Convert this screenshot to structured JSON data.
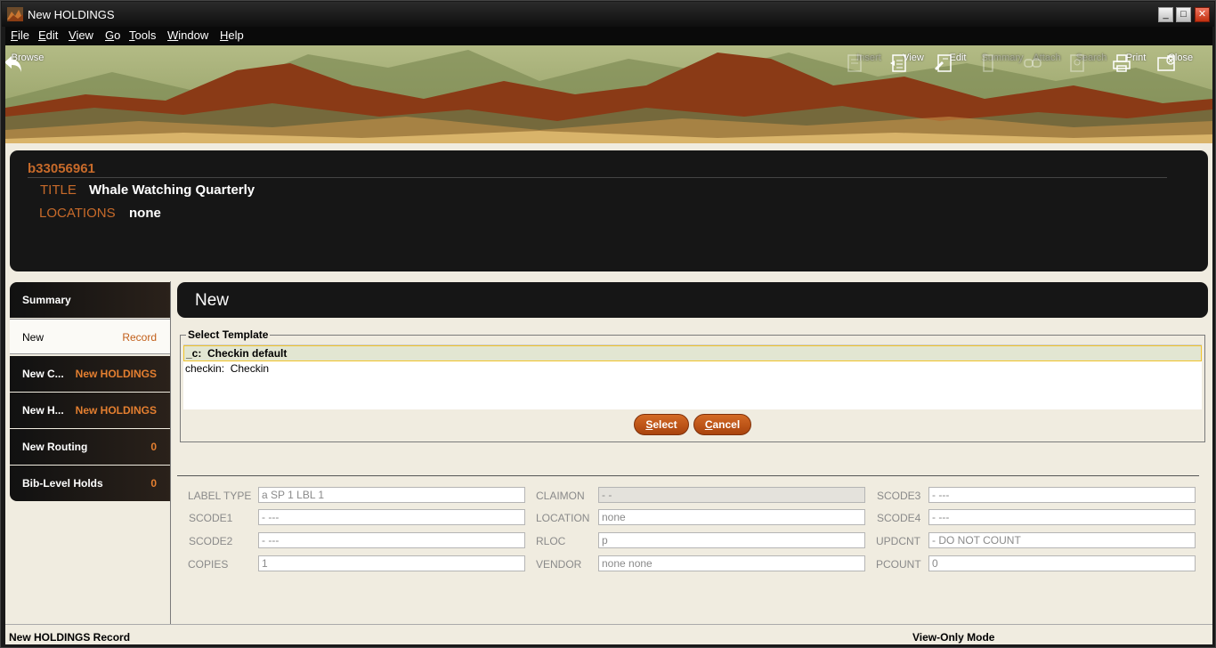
{
  "window": {
    "title": "New HOLDINGS",
    "controls": {
      "minimize": "_",
      "maximize": "□",
      "close": "✕"
    }
  },
  "menu": [
    "File",
    "Edit",
    "View",
    "Go",
    "Tools",
    "Window",
    "Help"
  ],
  "toolbar": {
    "browse": "Browse",
    "right": [
      {
        "label": "Insert",
        "icon": "insert-icon",
        "enabled": false
      },
      {
        "label": "View",
        "icon": "view-icon",
        "enabled": true
      },
      {
        "label": "Edit",
        "icon": "edit-icon",
        "enabled": true
      },
      {
        "label": "Summary",
        "icon": "summary-icon",
        "enabled": false
      },
      {
        "label": "Attach",
        "icon": "attach-icon",
        "enabled": false
      },
      {
        "label": "Search",
        "icon": "search-icon",
        "enabled": false
      },
      {
        "label": "Print",
        "icon": "print-icon",
        "enabled": true
      },
      {
        "label": "Close",
        "icon": "close-icon",
        "enabled": true
      }
    ]
  },
  "record": {
    "number": "b33056961",
    "title_label": "TITLE",
    "title_value": "Whale Watching Quarterly",
    "locations_label": "LOCATIONS",
    "locations_value": "none"
  },
  "nav": [
    {
      "label": "Summary",
      "value": ""
    },
    {
      "label": "New",
      "value": "Record"
    },
    {
      "label": "New C...",
      "value": "New HOLDINGS"
    },
    {
      "label": "New H...",
      "value": "New HOLDINGS"
    },
    {
      "label": "New Routing",
      "value": "0"
    },
    {
      "label": "Bib-Level Holds",
      "value": "0"
    }
  ],
  "panel": {
    "title": "New",
    "template_legend": "Select Template",
    "templates": [
      {
        "code": "_c:",
        "name": "Checkin default",
        "selected": true
      },
      {
        "code": "checkin:",
        "name": "Checkin",
        "selected": false
      }
    ],
    "select_label": "Select",
    "cancel_label": "Cancel"
  },
  "fields": {
    "col1": [
      {
        "label": "LABEL TYPE",
        "value": "a  SP 1 LBL 1"
      },
      {
        "label": "SCODE1",
        "value": "-  ---"
      },
      {
        "label": "SCODE2",
        "value": "-  ---"
      },
      {
        "label": "COPIES",
        "value": "1"
      }
    ],
    "col2": [
      {
        "label": "CLAIMON",
        "value": "-  -"
      },
      {
        "label": "LOCATION",
        "value": "none"
      },
      {
        "label": "RLOC",
        "value": "p"
      },
      {
        "label": "VENDOR",
        "value": "none  none"
      }
    ],
    "col3": [
      {
        "label": "SCODE3",
        "value": "-  ---"
      },
      {
        "label": "SCODE4",
        "value": "-  ---"
      },
      {
        "label": "UPDCNT",
        "value": "-  DO NOT COUNT"
      },
      {
        "label": "PCOUNT",
        "value": "0"
      }
    ]
  },
  "status": {
    "left": "New HOLDINGS Record",
    "right": "View-Only Mode"
  },
  "colors": {
    "accent": "#c76a2a",
    "dark_panel": "#161616",
    "content_bg": "#f0ece0"
  }
}
